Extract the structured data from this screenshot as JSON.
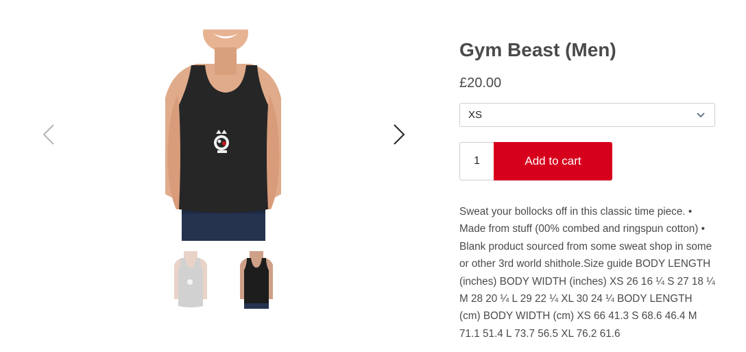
{
  "product": {
    "title": "Gym Beast (Men)",
    "price": "£20.00",
    "size_selected": "XS",
    "quantity": "1",
    "add_to_cart_label": "Add to cart",
    "description": "Sweat your bollocks off in this classic time piece. • Made from stuff (00% combed and ringspun cotton) • Blank product sourced from some sweat shop in some or other 3rd world shithole.Size guide BODY LENGTH (inches) BODY WIDTH (inches) XS 26 16 ¼ S 27 18 ¼ M 28 20 ¼ L 29 22 ¼ XL 30 24 ¼ BODY LENGTH (cm) BODY WIDTH (cm) XS 66 41.3 S 68.6 46.4 M 71.1 51.4 L 73.7 56.5 XL 76.2 61.6"
  },
  "gallery": {
    "prev_icon": "chevron-left-icon",
    "next_icon": "chevron-right-icon",
    "thumbnails": [
      "grey-tank-top",
      "black-tank-top"
    ]
  },
  "colors": {
    "accent": "#d6001c",
    "text": "#4a4a4a",
    "border": "#cfcfcf"
  }
}
